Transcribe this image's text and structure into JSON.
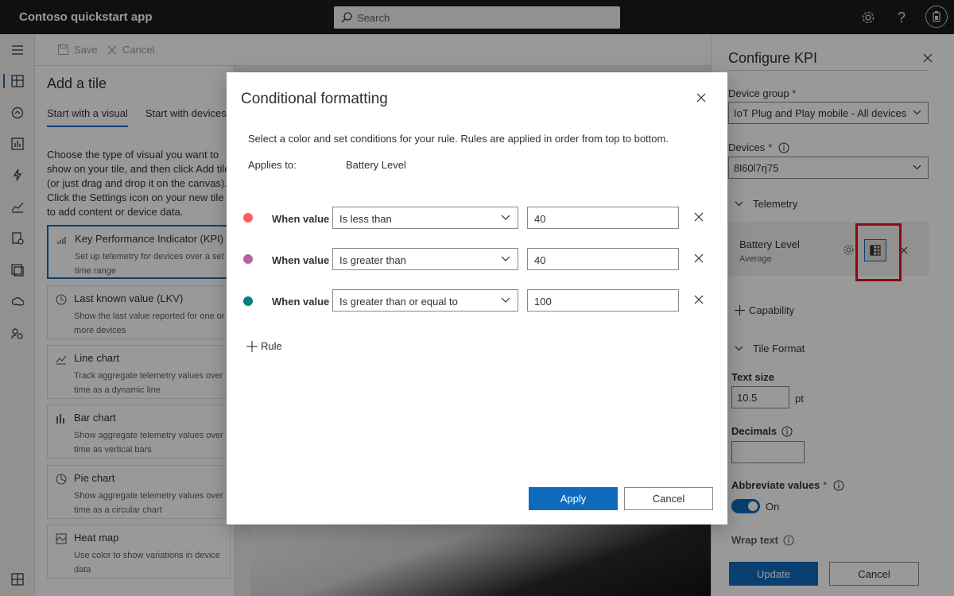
{
  "header": {
    "app_title": "Contoso quickstart app",
    "search_placeholder": "Search"
  },
  "leftnav": {
    "items": [
      "menu",
      "dashboards",
      "devices",
      "device-groups",
      "rules",
      "analytics",
      "jobs",
      "device-templates",
      "data-export",
      "administration",
      "dashboard-bottom"
    ]
  },
  "toolbar": {
    "save_label": "Save",
    "cancel_label": "Cancel"
  },
  "add_tile": {
    "title": "Add a tile",
    "tabs": [
      {
        "label": "Start with a visual",
        "selected": true
      },
      {
        "label": "Start with devices",
        "selected": false
      }
    ],
    "intro": "Choose the type of visual you want to show on your tile, and then click Add tile (or just drag and drop it on the canvas). Click the Settings icon on your new tile to add content or device data.",
    "visuals": [
      {
        "title": "Key Performance Indicator (KPI)",
        "desc": "Set up telemetry for devices over a set time range",
        "icon": "kpi-icon"
      },
      {
        "title": "Last known value (LKV)",
        "desc": "Show the last value reported for one or more devices",
        "icon": "clock-icon"
      },
      {
        "title": "Line chart",
        "desc": "Track aggregate telemetry values over time as a dynamic line",
        "icon": "line-chart-icon"
      },
      {
        "title": "Bar chart",
        "desc": "Show aggregate telemetry values over time as vertical bars",
        "icon": "bar-chart-icon"
      },
      {
        "title": "Pie chart",
        "desc": "Show aggregate telemetry values over time as a circular chart",
        "icon": "pie-chart-icon"
      },
      {
        "title": "Heat map",
        "desc": "Use color to show variations in device data",
        "icon": "heat-map-icon"
      }
    ]
  },
  "configure_kpi": {
    "title": "Configure KPI",
    "device_group_label": "Device group",
    "device_group_value": "IoT Plug and Play mobile - All devices",
    "devices_label": "Devices",
    "devices_value": "8l60l7rj75",
    "telemetry_label": "Telemetry",
    "telemetry_item": {
      "name": "Battery Level",
      "aggregation": "Average"
    },
    "capability_label": "Capability",
    "tile_format_label": "Tile Format",
    "text_size_label": "Text size",
    "text_size_value": "10.5",
    "text_size_unit": "pt",
    "decimals_label": "Decimals",
    "decimals_value": "",
    "abbreviate_label": "Abbreviate values",
    "abbreviate_state": "On",
    "wrap_text_label": "Wrap text",
    "update_label": "Update",
    "cancel_label": "Cancel"
  },
  "modal": {
    "title": "Conditional formatting",
    "description": "Select a color and set conditions for your rule. Rules are applied in order from top to bottom.",
    "applies_to_label": "Applies to:",
    "applies_to_value": "Battery Level",
    "rules": [
      {
        "color": "#ff5d5d",
        "when_label": "When value",
        "condition": "Is less than",
        "value": "40"
      },
      {
        "color": "#b4649e",
        "when_label": "When value",
        "condition": "Is greater than",
        "value": "40"
      },
      {
        "color": "#03827c",
        "when_label": "When value",
        "condition": "Is greater than or equal to",
        "value": "100"
      }
    ],
    "add_rule_label": "Rule",
    "apply_label": "Apply",
    "cancel_label": "Cancel"
  },
  "colors": {
    "accent": "#0f6cbd",
    "header_bg": "#1b1b1b",
    "highlight": "#e81123"
  }
}
